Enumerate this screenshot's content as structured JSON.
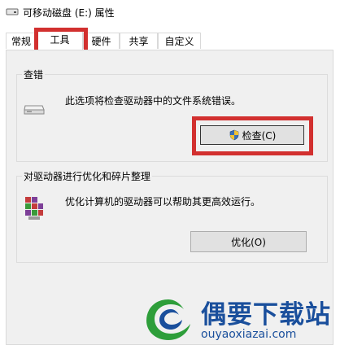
{
  "window": {
    "title": "可移动磁盘 (E:) 属性"
  },
  "tabs": [
    {
      "label": "常规"
    },
    {
      "label": "工具"
    },
    {
      "label": "硬件"
    },
    {
      "label": "共享"
    },
    {
      "label": "自定义"
    }
  ],
  "active_tab": "工具",
  "error_check": {
    "title": "查错",
    "description": "此选项将检查驱动器中的文件系统错误。",
    "button_label": "检查(C)",
    "button_icon": "shield-icon"
  },
  "optimize": {
    "title": "对驱动器进行优化和碎片整理",
    "description": "优化计算机的驱动器可以帮助其更高效运行。",
    "button_label": "优化(O)"
  },
  "watermark": {
    "brand": "偶要下载站",
    "url": "ouyaoxiazai.com"
  },
  "colors": {
    "highlight": "#d2302f",
    "watermark": "#1a4f9c"
  }
}
